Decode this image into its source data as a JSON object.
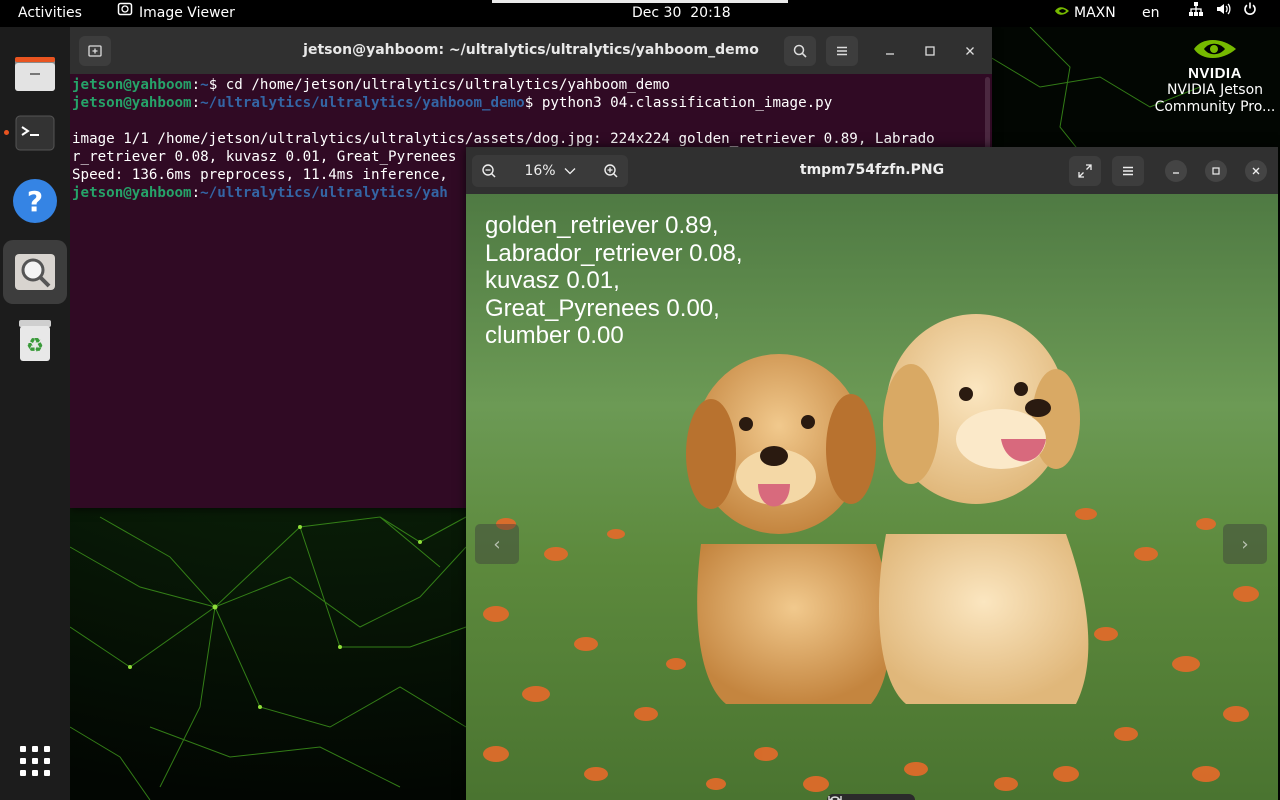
{
  "topbar": {
    "activities": "Activities",
    "app_name": "Image Viewer",
    "date": "Dec 30",
    "time": "20:18",
    "power_mode": "MAXN",
    "language": "en"
  },
  "desktop": {
    "brand": "NVIDIA",
    "label_line1": "NVIDIA Jetson",
    "label_line2": "Community Pro...",
    "accent": "#76b900"
  },
  "dock": {
    "items": [
      "files-icon",
      "terminal-icon",
      "help-icon",
      "image-viewer-icon",
      "trash-icon",
      "show-apps-icon"
    ]
  },
  "terminal": {
    "title": "jetson@yahboom: ~/ultralytics/ultralytics/yahboom_demo",
    "user_host": "jetson@yahboom",
    "line1_path": "~",
    "line1_cmd": "$ cd /home/jetson/ultralytics/ultralytics/yahboom_demo",
    "line2_path": "~/ultralytics/ultralytics/yahboom_demo",
    "line2_cmd": "$ python3 04.classification_image.py",
    "output1": "image 1/1 /home/jetson/ultralytics/ultralytics/assets/dog.jpg: 224x224 golden_retriever 0.89, Labrado",
    "output2": "r_retriever 0.08, kuvasz 0.01, Great_Pyrenees",
    "output3": "Speed: 136.6ms preprocess, 11.4ms inference,",
    "line4_path": "~/ultralytics/ultralytics/yah",
    "bg_color": "#300a24",
    "user_color": "#26a269",
    "path_color": "#3465a4"
  },
  "viewer": {
    "title": "tmpm754fzfn.PNG",
    "zoom": "16%",
    "overlay_lines": [
      "golden_retriever 0.89,",
      "Labrador_retriever 0.08,",
      "kuvasz 0.01,",
      "Great_Pyrenees 0.00,",
      "clumber 0.00"
    ]
  }
}
